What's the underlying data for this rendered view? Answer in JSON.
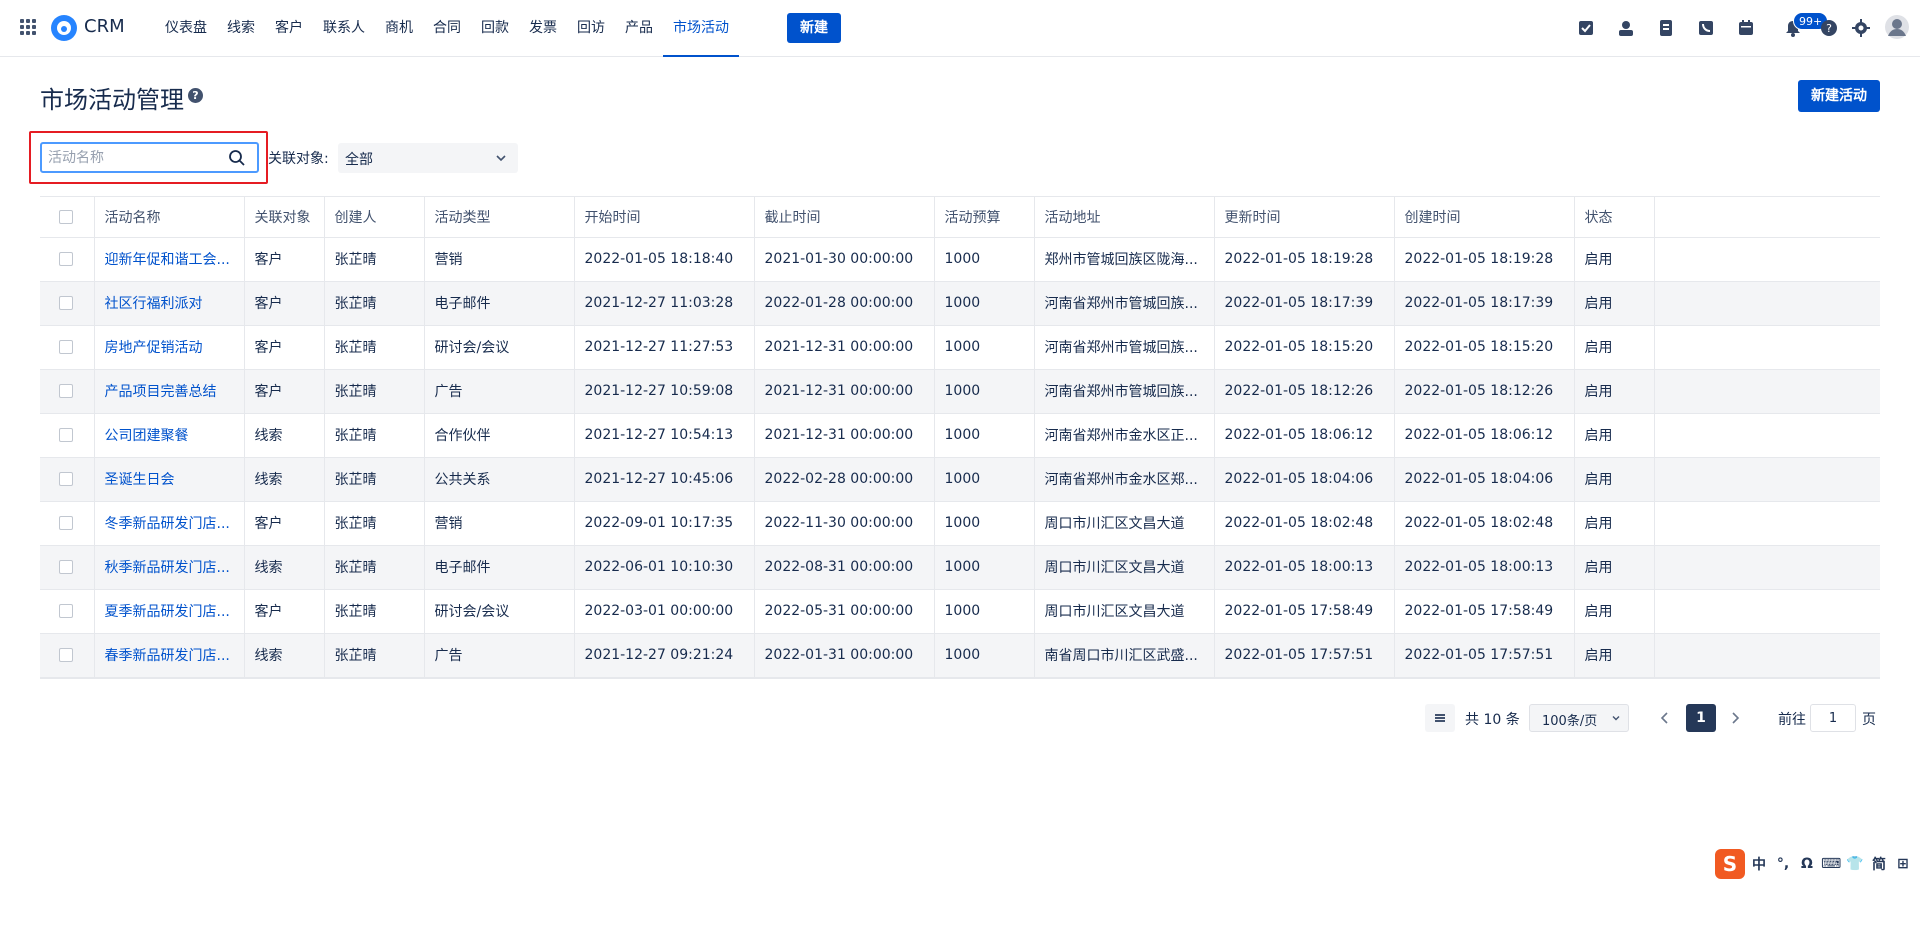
{
  "app": {
    "brand": "CRM"
  },
  "nav": {
    "items": [
      "仪表盘",
      "线索",
      "客户",
      "联系人",
      "商机",
      "合同",
      "回款",
      "发票",
      "回访",
      "产品",
      "市场活动"
    ],
    "active_index": 10,
    "new_label": "新建"
  },
  "toolbar": {
    "icons": [
      "checklist-icon",
      "user-icon",
      "document-icon",
      "phone-icon",
      "calendar-icon",
      "bell-icon",
      "help-icon",
      "gear-icon",
      "avatar-icon"
    ],
    "notification_badge": "99+"
  },
  "page": {
    "title": "市场活动管理",
    "help_glyph": "?",
    "create_label": "新建活动"
  },
  "filters": {
    "search_placeholder": "活动名称",
    "relation_label": "关联对象:",
    "relation_value": "全部"
  },
  "table": {
    "columns": [
      "活动名称",
      "关联对象",
      "创建人",
      "活动类型",
      "开始时间",
      "截止时间",
      "活动预算",
      "活动地址",
      "更新时间",
      "创建时间",
      "状态"
    ],
    "rows": [
      [
        "迎新年促和谐工会...",
        "客户",
        "张芷晴",
        "营销",
        "2022-01-05 18:18:40",
        "2021-01-30 00:00:00",
        "1000",
        "郑州市管城回族区陇海...",
        "2022-01-05 18:19:28",
        "2022-01-05 18:19:28",
        "启用"
      ],
      [
        "社区行福利派对",
        "客户",
        "张芷晴",
        "电子邮件",
        "2021-12-27 11:03:28",
        "2022-01-28 00:00:00",
        "1000",
        "河南省郑州市管城回族...",
        "2022-01-05 18:17:39",
        "2022-01-05 18:17:39",
        "启用"
      ],
      [
        "房地产促销活动",
        "客户",
        "张芷晴",
        "研讨会/会议",
        "2021-12-27 11:27:53",
        "2021-12-31 00:00:00",
        "1000",
        "河南省郑州市管城回族...",
        "2022-01-05 18:15:20",
        "2022-01-05 18:15:20",
        "启用"
      ],
      [
        "产品项目完善总结",
        "客户",
        "张芷晴",
        "广告",
        "2021-12-27 10:59:08",
        "2021-12-31 00:00:00",
        "1000",
        "河南省郑州市管城回族...",
        "2022-01-05 18:12:26",
        "2022-01-05 18:12:26",
        "启用"
      ],
      [
        "公司团建聚餐",
        "线索",
        "张芷晴",
        "合作伙伴",
        "2021-12-27 10:54:13",
        "2021-12-31 00:00:00",
        "1000",
        "河南省郑州市金水区正...",
        "2022-01-05 18:06:12",
        "2022-01-05 18:06:12",
        "启用"
      ],
      [
        "圣诞生日会",
        "线索",
        "张芷晴",
        "公共关系",
        "2021-12-27 10:45:06",
        "2022-02-28 00:00:00",
        "1000",
        "河南省郑州市金水区郑...",
        "2022-01-05 18:04:06",
        "2022-01-05 18:04:06",
        "启用"
      ],
      [
        "冬季新品研发门店...",
        "客户",
        "张芷晴",
        "营销",
        "2022-09-01 10:17:35",
        "2022-11-30 00:00:00",
        "1000",
        "周口市川汇区文昌大道",
        "2022-01-05 18:02:48",
        "2022-01-05 18:02:48",
        "启用"
      ],
      [
        "秋季新品研发门店...",
        "线索",
        "张芷晴",
        "电子邮件",
        "2022-06-01 10:10:30",
        "2022-08-31 00:00:00",
        "1000",
        "周口市川汇区文昌大道",
        "2022-01-05 18:00:13",
        "2022-01-05 18:00:13",
        "启用"
      ],
      [
        "夏季新品研发门店...",
        "客户",
        "张芷晴",
        "研讨会/会议",
        "2022-03-01 00:00:00",
        "2022-05-31 00:00:00",
        "1000",
        "周口市川汇区文昌大道",
        "2022-01-05 17:58:49",
        "2022-01-05 17:58:49",
        "启用"
      ],
      [
        "春季新品研发门店...",
        "线索",
        "张芷晴",
        "广告",
        "2021-12-27 09:21:24",
        "2022-01-31 00:00:00",
        "1000",
        "南省周口市川汇区武盛...",
        "2022-01-05 17:57:51",
        "2022-01-05 17:57:51",
        "启用"
      ]
    ]
  },
  "pagination": {
    "total_text": "共 10 条",
    "page_size": "100条/页",
    "current_page": "1",
    "goto_label": "前往",
    "goto_value": "1",
    "page_unit": "页"
  },
  "ime": {
    "logo": "S",
    "items": [
      "中",
      "°,",
      "Ω",
      "⌨",
      "👕",
      "简",
      "⊞"
    ]
  }
}
